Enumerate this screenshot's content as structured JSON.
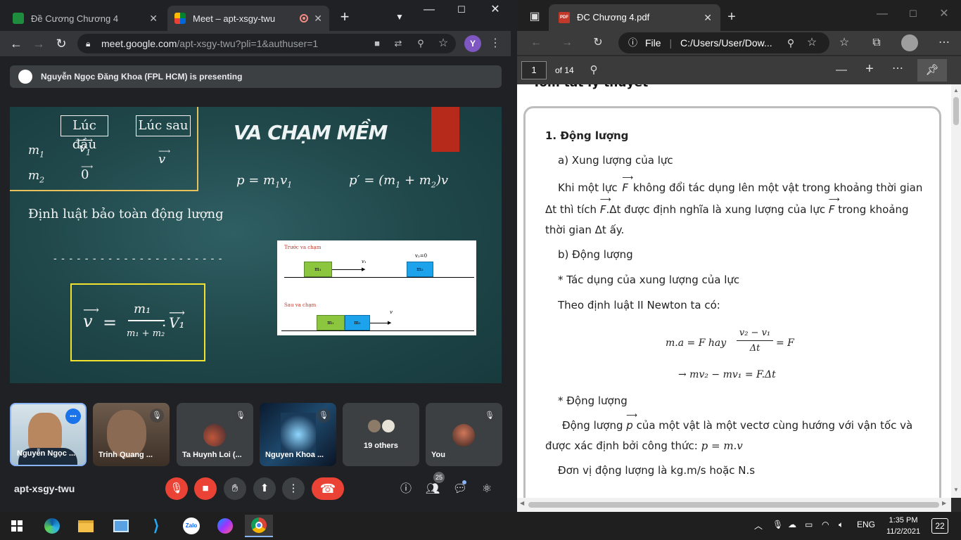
{
  "chrome": {
    "tabs": [
      {
        "title": "Đề Cương Chương 4",
        "favicon": "green-slides-icon",
        "active": false
      },
      {
        "title": "Meet – apt-xsgy-twu",
        "favicon": "meet-icon",
        "active": true,
        "recording_indicator": "record-icon"
      }
    ],
    "new_tab_label": "+",
    "address": {
      "host": "meet.google.com",
      "path": "/apt-xsgy-twu?pli=1&authuser=1"
    },
    "profile_initial": "Y"
  },
  "meet": {
    "presenter_banner": "Nguyễn Ngọc Đăng Khoa (FPL HCM) is presenting",
    "slide": {
      "title": "VA CHẠM MỀM",
      "before_label": "Lúc đầu",
      "after_label": "Lúc sau",
      "m1": "m",
      "m1_sub": "1",
      "m2": "m",
      "m2_sub": "2",
      "v1": "v",
      "v1_sub": "1",
      "zero": "0",
      "v": "v",
      "eq1": "p = m",
      "eq1_sub": "1",
      "eq1_tail": "v",
      "eq1_tail_sub": "1",
      "eq2": "p′ = (m",
      "eq2_sub1": "1",
      "eq2_mid": " + m",
      "eq2_sub2": "2",
      "eq2_tail": ")v",
      "law": "Định luật bảo toàn động lượng",
      "dashes": "- - - - - - - - - - - - - - - - - - - - - -",
      "hand_v": "v",
      "hand_eq": "=",
      "hand_num": "m₁",
      "hand_den": "m₁ + m₂",
      "hand_dot": ".",
      "hand_v1": "V₁",
      "figure": {
        "before": "Trước va chạm",
        "after": "Sau va chạm",
        "m1": "m₁",
        "m2": "m₂",
        "v1": "v₁",
        "v2": "v₂=0",
        "v": "v"
      }
    },
    "participants": [
      {
        "name": "Nguyễn Ngọc ...",
        "more": "•••"
      },
      {
        "name": "Trinh Quang ..."
      },
      {
        "name": "Ta Huynh Loi (..."
      },
      {
        "name": "Nguyen Khoa ..."
      },
      {
        "name": "19 others"
      },
      {
        "name": "You"
      }
    ],
    "meeting_code": "apt-xsgy-twu",
    "people_count": "25",
    "colors": {
      "red": "#ea4335",
      "tile_border": "#8ab4f8"
    }
  },
  "edge": {
    "tab_title": "ĐC Chương 4.pdf",
    "pdf_badge": "PDF",
    "file_label": "File",
    "address": "C:/Users/User/Dow...",
    "page": "1",
    "page_total": "of 14",
    "heading_cut": "Tóm tắt lý thuyết",
    "content": {
      "s1": "1. Động lượng",
      "a": "a) Xung lượng của lực",
      "p1a": "Khi một lực",
      "p1b": "không đổi tác dụng lên một vật trong khoảng thời gian",
      "p2a": "Δt thì tích",
      "p2b": ".Δt được định nghĩa là xung lượng của lực",
      "p2c": "trong khoảng",
      "p3": "thời gian Δt ấy.",
      "b": "b) Động lượng",
      "star1": "* Tác dụng của xung lượng của lực",
      "newton": "Theo định luật II Newton ta có:",
      "f1": "m.a = F hay",
      "f1_num": "v₂ − v₁",
      "f1_den": "Δt",
      "f1_tail": "= F",
      "f2": "→ mv₂ − mv₁ = F.Δt",
      "star2": "* Động lượng",
      "p4a": "Động lượng",
      "p4b": "của một vật là một vectơ cùng hướng với vận tốc và",
      "p5": "được xác định bởi công thức:",
      "p5_formula": "p = m.v",
      "unit": "Đơn vị động lượng là kg.m/s hoặc N.s",
      "F": "F",
      "p": "p"
    }
  },
  "taskbar": {
    "language": "ENG",
    "time": "1:35 PM",
    "date": "11/2/2021",
    "notifications": "22",
    "apps": [
      "windows-start-icon",
      "edge-icon",
      "file-explorer-icon",
      "control-panel-icon",
      "vscode-icon",
      "zalo-icon",
      "messenger-icon",
      "chrome-icon"
    ],
    "zalo_label": "Zalo"
  }
}
